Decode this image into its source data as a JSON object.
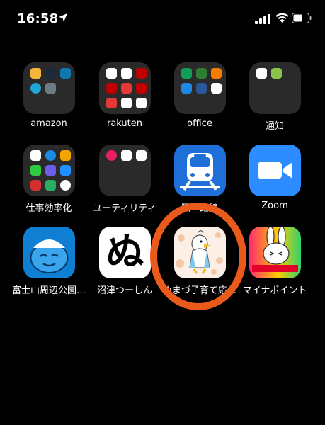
{
  "status_bar": {
    "time": "16:58"
  },
  "apps": {
    "amazon": {
      "label": "amazon",
      "kind": "folder"
    },
    "rakuten": {
      "label": "rakuten",
      "kind": "folder"
    },
    "office": {
      "label": "office",
      "kind": "folder"
    },
    "tsuchi": {
      "label": "通知",
      "kind": "folder"
    },
    "shigoto": {
      "label": "仕事効率化",
      "kind": "folder"
    },
    "utility": {
      "label": "ユーティリティ",
      "kind": "folder"
    },
    "train": {
      "label": "駅・路線",
      "kind": "app"
    },
    "zoom": {
      "label": "Zoom",
      "kind": "app"
    },
    "fuji": {
      "label": "富士山周辺公園…",
      "kind": "app"
    },
    "numazu_shinkin": {
      "label": "沼津つーしん",
      "kind": "app"
    },
    "numazu_kosodate": {
      "label": "ぬまづ子育て応…",
      "kind": "app"
    },
    "mynapoint": {
      "label": "マイナポイント",
      "kind": "app"
    }
  },
  "icon_glyphs": {
    "nu": "ぬ"
  },
  "highlight": {
    "color": "#ea5a1b",
    "target": "numazu_kosodate"
  }
}
